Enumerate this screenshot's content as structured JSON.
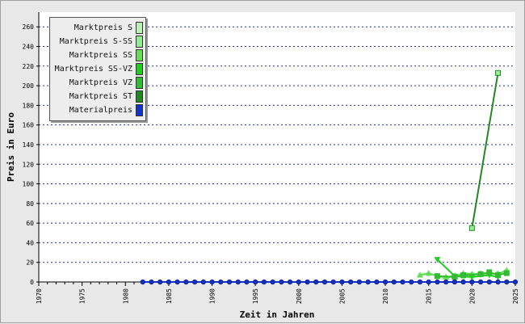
{
  "chart_data": {
    "type": "line",
    "title": "",
    "xlabel": "Zeit in Jahren",
    "ylabel": "Preis in Euro",
    "xlim": [
      1970,
      2025
    ],
    "ylim": [
      0,
      275
    ],
    "x_ticks": [
      1970,
      1975,
      1980,
      1985,
      1990,
      1995,
      2000,
      2005,
      2010,
      2015,
      2020,
      2025
    ],
    "y_ticks": [
      0,
      20,
      40,
      60,
      80,
      100,
      120,
      140,
      160,
      180,
      200,
      220,
      240,
      260
    ],
    "grid": "horizontal dotted",
    "legend_position": "top-left",
    "series": [
      {
        "name": "Marktpreis S",
        "color": "#b8f0b8",
        "marker": "circle",
        "points": [
          [
            2014,
            7
          ],
          [
            2015,
            8
          ],
          [
            2016,
            6
          ],
          [
            2017,
            5
          ],
          [
            2018,
            7
          ],
          [
            2019,
            6
          ],
          [
            2020,
            5
          ],
          [
            2021,
            7
          ],
          [
            2022,
            9
          ],
          [
            2023,
            8
          ],
          [
            2024,
            10
          ]
        ]
      },
      {
        "name": "Marktpreis S-SS",
        "color": "#90ee90",
        "marker": "circle",
        "points": [
          [
            2016,
            5
          ],
          [
            2017,
            4
          ],
          [
            2018,
            6
          ],
          [
            2019,
            5
          ],
          [
            2020,
            8
          ],
          [
            2021,
            9
          ],
          [
            2022,
            8
          ],
          [
            2023,
            9
          ],
          [
            2024,
            11
          ]
        ]
      },
      {
        "name": "Marktpreis SS",
        "color": "#66dd55",
        "marker": "triangle-up",
        "points": [
          [
            2014,
            7
          ],
          [
            2015,
            9
          ],
          [
            2016,
            6
          ],
          [
            2017,
            5
          ],
          [
            2018,
            6
          ],
          [
            2019,
            9
          ],
          [
            2020,
            8
          ],
          [
            2021,
            8
          ],
          [
            2022,
            9
          ],
          [
            2023,
            8
          ],
          [
            2024,
            12
          ]
        ]
      },
      {
        "name": "Marktpreis SS-VZ",
        "color": "#22cc22",
        "marker": "triangle-down",
        "points": [
          [
            2016,
            23
          ],
          [
            2018,
            6
          ],
          [
            2020,
            5
          ],
          [
            2022,
            7
          ],
          [
            2023,
            5
          ]
        ]
      },
      {
        "name": "Marktpreis VZ",
        "color": "#33bb33",
        "marker": "square",
        "points": [
          [
            2016,
            6
          ],
          [
            2018,
            5
          ],
          [
            2019,
            7
          ],
          [
            2021,
            8
          ],
          [
            2022,
            10
          ],
          [
            2023,
            7
          ],
          [
            2024,
            9
          ]
        ]
      },
      {
        "name": "Marktpreis ST",
        "color": "#228822",
        "marker": "square",
        "points": [
          [
            2020,
            55
          ],
          [
            2023,
            213
          ]
        ]
      },
      {
        "name": "Materialpreis",
        "color": "#1133cc",
        "marker": "circle",
        "points": [
          [
            1982,
            0
          ],
          [
            1983,
            0
          ],
          [
            1984,
            0
          ],
          [
            1985,
            0
          ],
          [
            1986,
            0
          ],
          [
            1987,
            0
          ],
          [
            1988,
            0
          ],
          [
            1989,
            0
          ],
          [
            1990,
            0
          ],
          [
            1991,
            0
          ],
          [
            1992,
            0
          ],
          [
            1993,
            0
          ],
          [
            1994,
            0
          ],
          [
            1995,
            0
          ],
          [
            1996,
            0
          ],
          [
            1997,
            0
          ],
          [
            1998,
            0
          ],
          [
            1999,
            0
          ],
          [
            2000,
            0
          ],
          [
            2001,
            0
          ],
          [
            2002,
            0
          ],
          [
            2003,
            0
          ],
          [
            2004,
            0
          ],
          [
            2005,
            0
          ],
          [
            2006,
            0
          ],
          [
            2007,
            0
          ],
          [
            2008,
            0
          ],
          [
            2009,
            0
          ],
          [
            2010,
            0
          ],
          [
            2011,
            0
          ],
          [
            2012,
            0
          ],
          [
            2013,
            0
          ],
          [
            2014,
            0
          ],
          [
            2015,
            0
          ],
          [
            2016,
            0
          ],
          [
            2017,
            0
          ],
          [
            2018,
            0
          ],
          [
            2019,
            0
          ],
          [
            2020,
            0
          ],
          [
            2021,
            0
          ],
          [
            2022,
            0
          ],
          [
            2023,
            0
          ],
          [
            2024,
            0
          ],
          [
            2025,
            0
          ]
        ]
      }
    ]
  }
}
